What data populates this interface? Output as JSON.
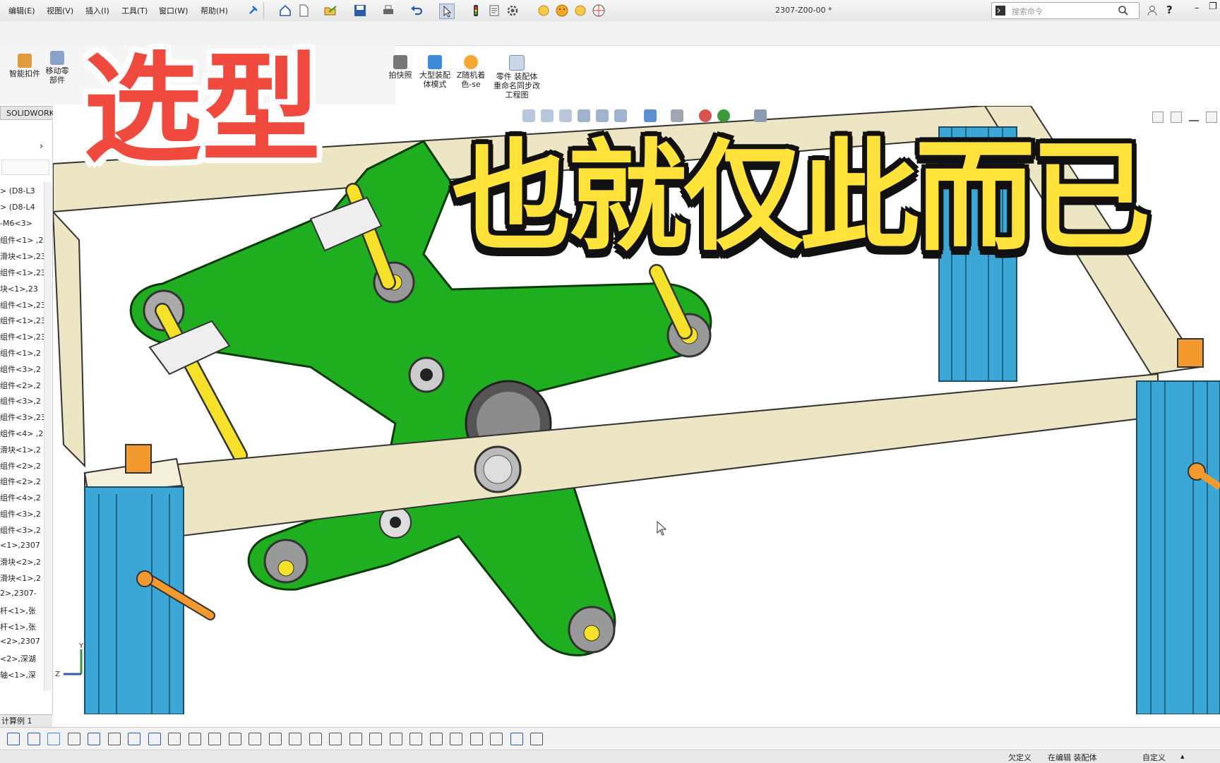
{
  "menu": {
    "items": [
      "编辑(E)",
      "视图(V)",
      "插入(I)",
      "工具(T)",
      "窗口(W)",
      "帮助(H)"
    ]
  },
  "toolbar": {
    "doc_title": "2307-Z00-00 *",
    "search_placeholder": "搜索命令",
    "help_label": "?"
  },
  "ribbon": {
    "buttons": [
      {
        "label": "智能扣件",
        "icon": "smart-fastener-icon"
      },
      {
        "label": "移动零部件",
        "icon": "move-component-icon"
      },
      {
        "label": "拍快照",
        "icon": "camera-icon"
      },
      {
        "label": "大型装配体模式",
        "icon": "large-assembly-icon"
      },
      {
        "label": "Z随机着色-se",
        "icon": "random-color-icon"
      },
      {
        "label": "零件 装配体重命名同步改工程图",
        "icon": "rename-sync-icon"
      }
    ],
    "tab_label": "SOLIDWORKS 插件"
  },
  "tree": {
    "items": [
      "> (D8-L3",
      "> (D8-L4",
      "-M6<3>",
      "组件<1> ,2",
      "滑块<1>,23",
      "组件<1>,23",
      "块<1>,23",
      "组件<1>,23",
      "组件<1>,23",
      "组件<1>,23",
      "组件<1>,2",
      "组件<3>,2",
      "组件<2>,2",
      "组件<3>,2",
      "组件<3>,23",
      "组件<4> ,2",
      "滑块<1>,2",
      "组件<2>,2",
      "组件<2>,2",
      "组件<4>,2",
      "组件<3>,2",
      "组件<3>,2",
      "<1>,2307",
      "滑块<2>,2",
      "滑块<1>,2",
      "2>,2307-",
      "杆<1>,张",
      "杆<1>,张",
      "<2>,2307",
      "<2>,深湖",
      "轴<1>,深"
    ]
  },
  "overlay": {
    "title_red": "选型",
    "title_yellow": "也就仅此而已"
  },
  "bottom_tab": "计算例 1",
  "axes": {
    "y": "Y",
    "z": "Z"
  },
  "status": {
    "underdefined": "欠定义",
    "editing": "在编辑 装配体",
    "custom": "自定义"
  },
  "colors": {
    "green_plate": "#1fae1f",
    "beam": "#ece6c4",
    "column": "#3aa7d6",
    "rod": "#f5e02a",
    "handle": "#f29a2e",
    "title_red": "#f04a3e",
    "title_yellow": "#ffe23a"
  }
}
